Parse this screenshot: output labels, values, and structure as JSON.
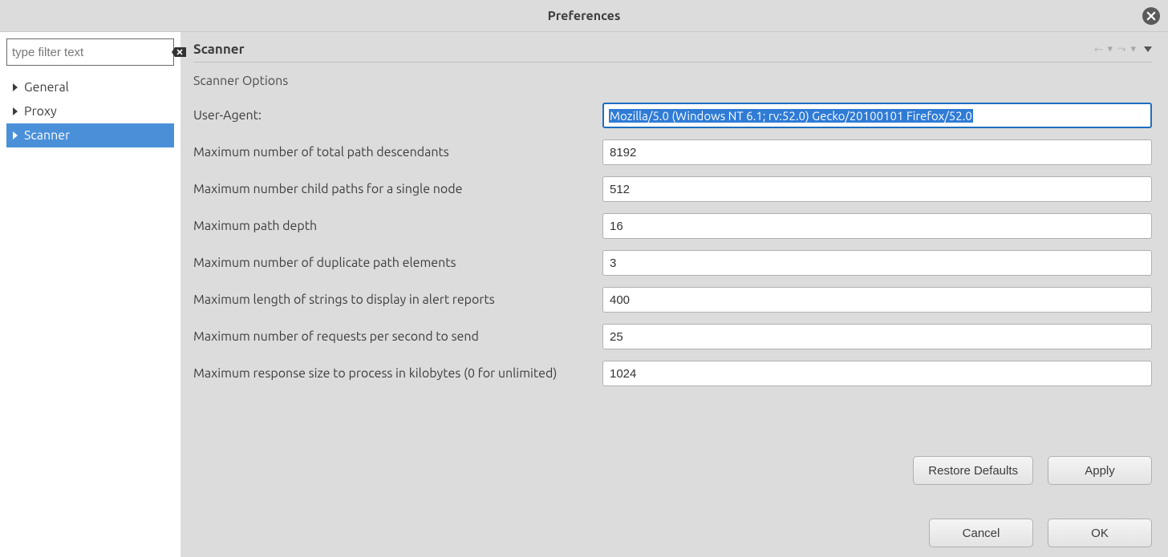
{
  "window": {
    "title": "Preferences"
  },
  "sidebar": {
    "filter_placeholder": "type filter text",
    "items": [
      {
        "label": "General",
        "selected": false
      },
      {
        "label": "Proxy",
        "selected": false
      },
      {
        "label": "Scanner",
        "selected": true
      }
    ]
  },
  "main": {
    "title": "Scanner",
    "section": "Scanner Options",
    "fields": [
      {
        "label": "User-Agent:",
        "value": "Mozilla/5.0 (Windows NT 6.1; rv:52.0) Gecko/20100101 Firefox/52.0",
        "highlight": true
      },
      {
        "label": "Maximum number of total path descendants",
        "value": "8192"
      },
      {
        "label": "Maximum number child paths for a single node",
        "value": "512"
      },
      {
        "label": "Maximum path depth",
        "value": "16"
      },
      {
        "label": "Maximum number of duplicate path elements",
        "value": "3"
      },
      {
        "label": "Maximum length of strings to display in alert reports",
        "value": "400"
      },
      {
        "label": "Maximum number of requests per second to send",
        "value": "25"
      },
      {
        "label": "Maximum response size to process in kilobytes (0 for unlimited)",
        "value": "1024"
      }
    ]
  },
  "buttons": {
    "restore": "Restore Defaults",
    "apply": "Apply",
    "cancel": "Cancel",
    "ok": "OK"
  }
}
